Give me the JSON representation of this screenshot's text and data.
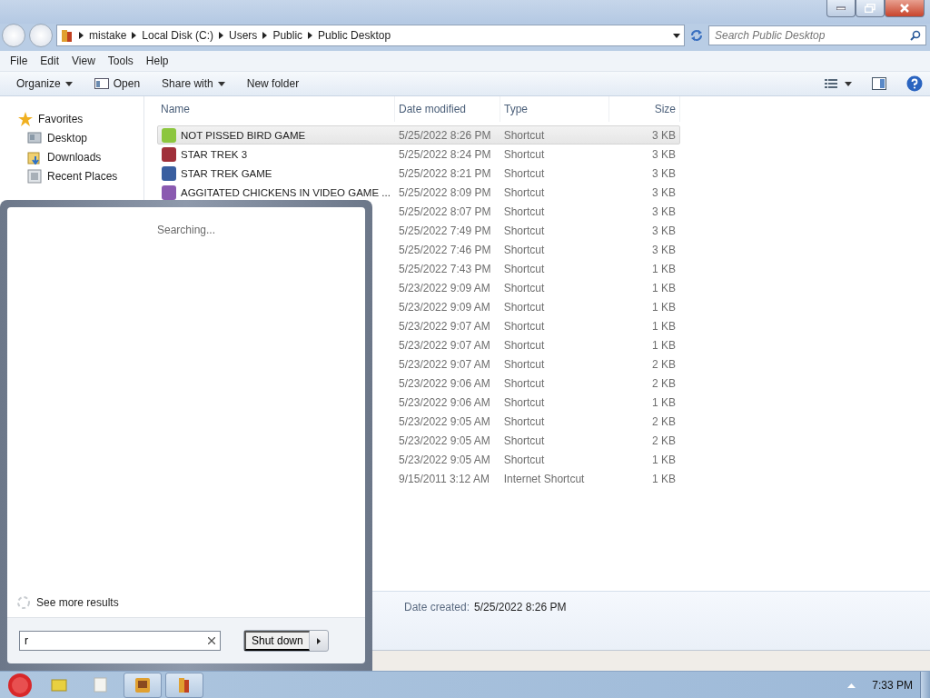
{
  "address_bar": {
    "breadcrumbs": [
      "mistake",
      "Local Disk (C:)",
      "Users",
      "Public",
      "Public Desktop"
    ]
  },
  "search": {
    "placeholder": "Search Public Desktop"
  },
  "menu_bar": [
    "File",
    "Edit",
    "View",
    "Tools",
    "Help"
  ],
  "toolbar": [
    {
      "label": "Organize",
      "dropdown": true,
      "kind": "plain"
    },
    {
      "label": "Open",
      "dropdown": false,
      "kind": "open"
    },
    {
      "label": "Share with",
      "dropdown": true,
      "kind": "plain"
    },
    {
      "label": "New folder",
      "dropdown": false,
      "kind": "plain"
    }
  ],
  "navigation": {
    "heading": "Favorites",
    "items": [
      "Desktop",
      "Downloads",
      "Recent Places"
    ]
  },
  "table": {
    "columns": [
      "Name",
      "Date modified",
      "Type",
      "Size"
    ],
    "rows": [
      {
        "name": "NOT PISSED BIRD GAME",
        "date": "5/25/2022 8:26 PM",
        "type": "Shortcut",
        "size": "3 KB",
        "selected": true,
        "color": "#8cc63e"
      },
      {
        "name": "STAR TREK 3",
        "date": "5/25/2022 8:24 PM",
        "type": "Shortcut",
        "size": "3 KB",
        "selected": false,
        "color": "#a0303a"
      },
      {
        "name": "STAR TREK GAME",
        "date": "5/25/2022 8:21 PM",
        "type": "Shortcut",
        "size": "3 KB",
        "selected": false,
        "color": "#3a5fa0"
      },
      {
        "name": "AGGITATED CHICKENS IN VIDEO GAME ...",
        "date": "5/25/2022 8:09 PM",
        "type": "Shortcut",
        "size": "3 KB",
        "selected": false,
        "color": "#8a5ab0"
      },
      {
        "date": "5/25/2022 8:07 PM",
        "type": "Shortcut",
        "size": "3 KB",
        "selected": false
      },
      {
        "date": "5/25/2022 7:49 PM",
        "type": "Shortcut",
        "size": "3 KB",
        "selected": false
      },
      {
        "date": "5/25/2022 7:46 PM",
        "type": "Shortcut",
        "size": "3 KB",
        "selected": false
      },
      {
        "date": "5/25/2022 7:43 PM",
        "type": "Shortcut",
        "size": "1 KB",
        "selected": false
      },
      {
        "date": "5/23/2022 9:09 AM",
        "type": "Shortcut",
        "size": "1 KB",
        "selected": false
      },
      {
        "date": "5/23/2022 9:09 AM",
        "type": "Shortcut",
        "size": "1 KB",
        "selected": false
      },
      {
        "date": "5/23/2022 9:07 AM",
        "type": "Shortcut",
        "size": "1 KB",
        "selected": false
      },
      {
        "date": "5/23/2022 9:07 AM",
        "type": "Shortcut",
        "size": "1 KB",
        "selected": false
      },
      {
        "date": "5/23/2022 9:07 AM",
        "type": "Shortcut",
        "size": "2 KB",
        "selected": false
      },
      {
        "date": "5/23/2022 9:06 AM",
        "type": "Shortcut",
        "size": "2 KB",
        "selected": false
      },
      {
        "date": "5/23/2022 9:06 AM",
        "type": "Shortcut",
        "size": "1 KB",
        "selected": false
      },
      {
        "date": "5/23/2022 9:05 AM",
        "type": "Shortcut",
        "size": "2 KB",
        "selected": false
      },
      {
        "date": "5/23/2022 9:05 AM",
        "type": "Shortcut",
        "size": "2 KB",
        "selected": false
      },
      {
        "date": "5/23/2022 9:05 AM",
        "type": "Shortcut",
        "size": "1 KB",
        "selected": false
      },
      {
        "date": "9/15/2011 3:12 AM",
        "type": "Internet Shortcut",
        "size": "1 KB",
        "selected": false
      }
    ]
  },
  "details": {
    "label": "Date created:",
    "value": "5/25/2022 8:26 PM"
  },
  "start_menu": {
    "status": "Searching...",
    "more_results": "See more results",
    "search": {
      "value": "r"
    },
    "shutdown": "Shut down"
  },
  "taskbar": {
    "buttons": [
      {
        "kind": "folder",
        "active": false
      },
      {
        "kind": "note",
        "active": false
      },
      {
        "kind": "game",
        "active": true
      },
      {
        "kind": "explorer",
        "active": true
      }
    ],
    "clock": "7:33 PM"
  }
}
